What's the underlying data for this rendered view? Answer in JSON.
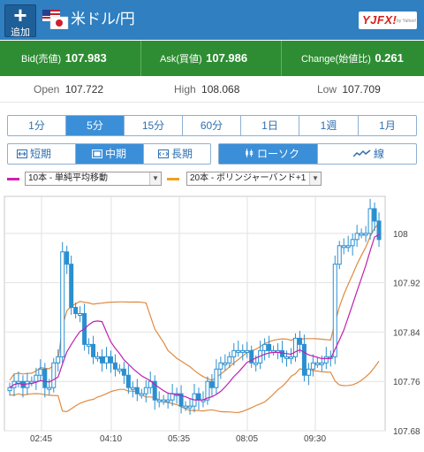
{
  "header": {
    "add_label": "追加",
    "add_symbol": "+",
    "pair_title": "米ドル/円",
    "logo_text": "YJFX!",
    "logo_sub": "by Yahoo!"
  },
  "quote": {
    "bid_label": "Bid(売値)",
    "bid_value": "107.983",
    "ask_label": "Ask(買値)",
    "ask_value": "107.986",
    "change_label": "Change(始値比)",
    "change_value": "0.261"
  },
  "stats": {
    "open_label": "Open",
    "open_value": "107.722",
    "high_label": "High",
    "high_value": "108.068",
    "low_label": "Low",
    "low_value": "107.709"
  },
  "timeframes": [
    {
      "label": "1分",
      "active": false
    },
    {
      "label": "5分",
      "active": true
    },
    {
      "label": "15分",
      "active": false
    },
    {
      "label": "60分",
      "active": false
    },
    {
      "label": "1日",
      "active": false
    },
    {
      "label": "1週",
      "active": false
    },
    {
      "label": "1月",
      "active": false
    }
  ],
  "terms": [
    {
      "label": "短期",
      "active": false
    },
    {
      "label": "中期",
      "active": true
    },
    {
      "label": "長期",
      "active": false
    }
  ],
  "chart_types": [
    {
      "label": "ローソク",
      "active": true
    },
    {
      "label": "線",
      "active": false
    }
  ],
  "indicators": {
    "ind1": {
      "value": "10本 - 単純平均移動",
      "color": "#d020b0"
    },
    "ind2": {
      "value": "20本 - ボリンジャーバンド+1",
      "color": "#f0a020"
    }
  },
  "colors": {
    "header_bg": "#2f7fc1",
    "quote_bg": "#2e8d33",
    "candle": "#2a8fd0",
    "ma_line": "#c020b0",
    "band_line": "#e08a40",
    "accent": "#3b8fd8"
  },
  "chart_data": {
    "type": "candlestick",
    "x_ticks": [
      "02:45",
      "04:10",
      "05:35",
      "08:05",
      "09:30"
    ],
    "y_ticks": [
      "108",
      "107.92",
      "107.84",
      "107.76",
      "107.68"
    ],
    "ylim": [
      107.68,
      108.06
    ],
    "series_close": [
      107.75,
      107.76,
      107.76,
      107.75,
      107.76,
      107.76,
      107.77,
      107.78,
      107.75,
      107.75,
      107.79,
      107.8,
      107.97,
      107.95,
      107.88,
      107.87,
      107.87,
      107.82,
      107.82,
      107.8,
      107.8,
      107.79,
      107.8,
      107.79,
      107.78,
      107.78,
      107.77,
      107.75,
      107.75,
      107.74,
      107.74,
      107.75,
      107.76,
      107.73,
      107.73,
      107.73,
      107.73,
      107.74,
      107.74,
      107.72,
      107.72,
      107.72,
      107.74,
      107.73,
      107.73,
      107.76,
      107.75,
      107.78,
      107.79,
      107.79,
      107.8,
      107.81,
      107.81,
      107.81,
      107.81,
      107.79,
      107.79,
      107.81,
      107.82,
      107.81,
      107.81,
      107.81,
      107.8,
      107.8,
      107.8,
      107.83,
      107.82,
      107.77,
      107.78,
      107.79,
      107.79,
      107.79,
      107.8,
      107.8,
      107.95,
      107.98,
      107.98,
      107.98,
      107.99,
      108.0,
      108.0,
      108.0,
      108.04,
      108.02,
      107.99
    ]
  }
}
